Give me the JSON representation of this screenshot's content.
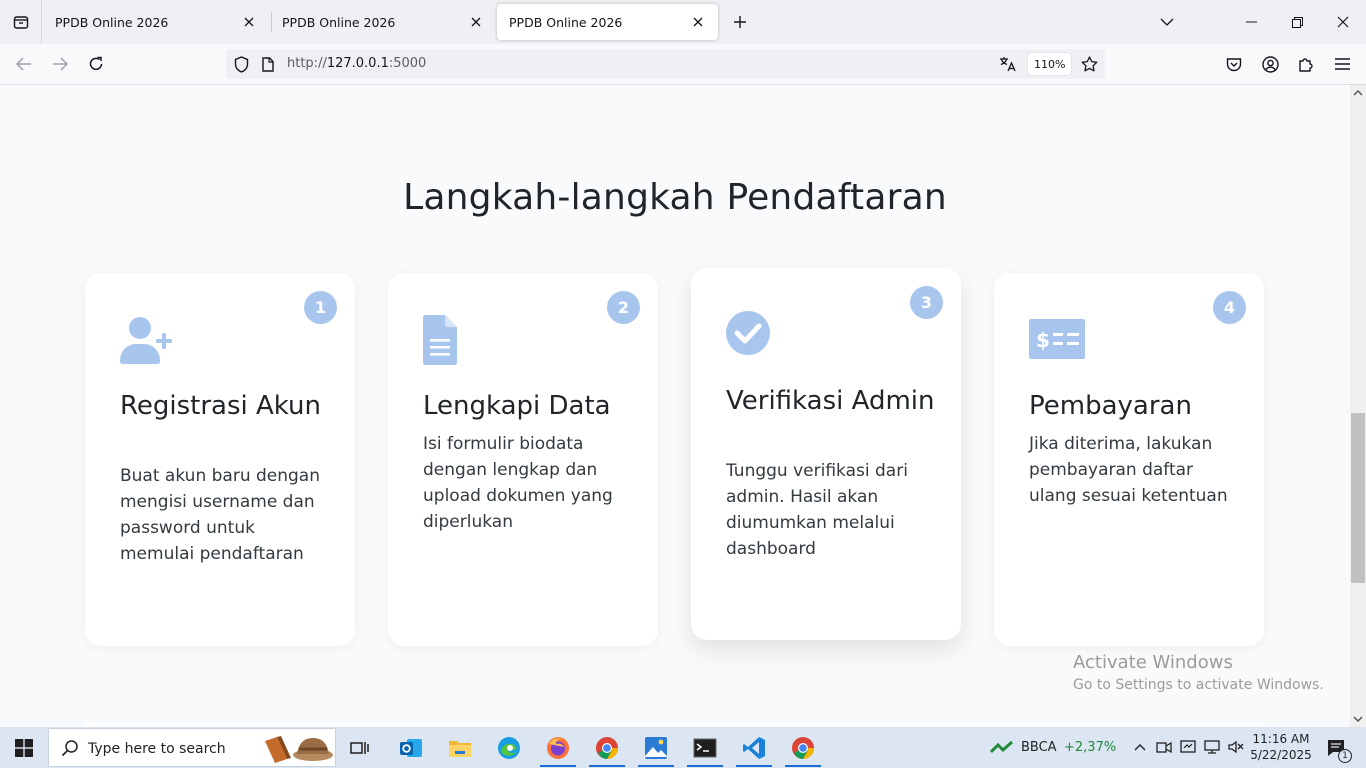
{
  "browser": {
    "tabs": [
      {
        "title": "PPDB Online 2026",
        "active": false
      },
      {
        "title": "PPDB Online 2026",
        "active": false
      },
      {
        "title": "PPDB Online 2026",
        "active": true
      }
    ],
    "url_prefix": "http://",
    "url_host": "127.0.0.1",
    "url_port": ":5000",
    "zoom": "110%"
  },
  "page": {
    "section_title": "Langkah-langkah Pendaftaran",
    "steps": [
      {
        "number": "1",
        "icon": "user-plus-icon",
        "title": "Registrasi Akun",
        "description": "Buat akun baru dengan mengisi username dan password untuk memulai pendaftaran"
      },
      {
        "number": "2",
        "icon": "document-icon",
        "title": "Lengkapi Data",
        "description": "Isi formulir biodata dengan lengkap dan upload dokumen yang diperlukan"
      },
      {
        "number": "3",
        "icon": "check-circle-icon",
        "title": "Verifikasi Admin",
        "description": "Tunggu verifikasi dari admin. Hasil akan diumumkan melalui dashboard"
      },
      {
        "number": "4",
        "icon": "money-bill-icon",
        "title": "Pembayaran",
        "description": "Jika diterima, lakukan pembayaran daftar ulang sesuai ketentuan"
      }
    ],
    "watermark_line1": "Activate Windows",
    "watermark_line2": "Go to Settings to activate Windows."
  },
  "taskbar": {
    "search_placeholder": "Type here to search",
    "stock_symbol": "BBCA",
    "stock_change": "+2,37%",
    "time": "11:16 AM",
    "date": "5/22/2025",
    "notification_count": "1"
  },
  "colors": {
    "accent_icon": "#a8c5ee",
    "stock_up": "#1e8a3a",
    "page_bg": "#f9fafb"
  }
}
